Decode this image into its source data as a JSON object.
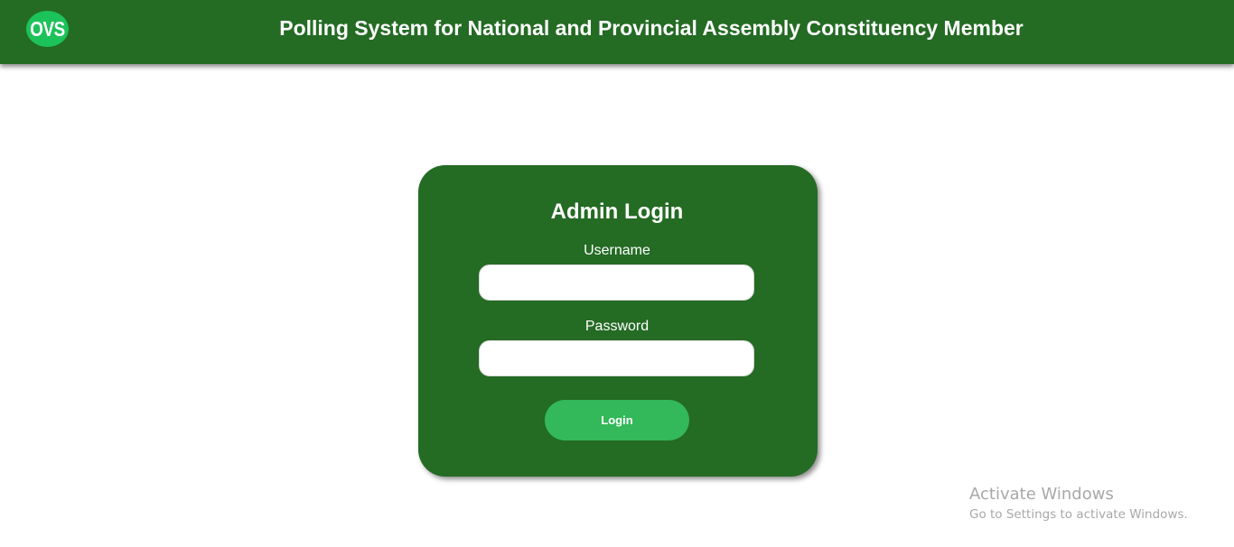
{
  "header": {
    "logo_text": "OVS",
    "title": "Polling System for National and Provincial Assembly Constituency Member"
  },
  "login_card": {
    "title": "Admin Login",
    "username_label": "Username",
    "username_value": "",
    "password_label": "Password",
    "password_value": "",
    "login_button_label": "Login"
  },
  "watermark": {
    "title": "Activate Windows",
    "subtitle": "Go to Settings to activate Windows."
  },
  "colors": {
    "primary_green": "#246b24",
    "logo_green": "#1cc25a",
    "button_green": "#33b85a",
    "text_white": "#ffffff",
    "watermark_gray": "#a8a8a8"
  }
}
